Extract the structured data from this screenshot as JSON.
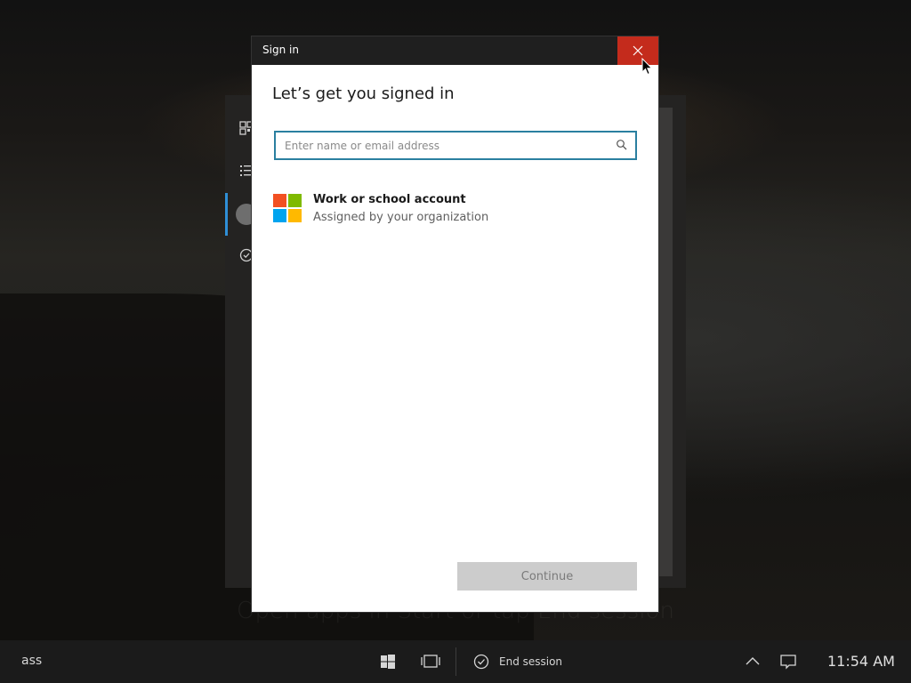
{
  "dialog": {
    "title": "Sign in",
    "heading": "Let’s get you signed in",
    "search": {
      "placeholder": "Enter name or email address",
      "value": ""
    },
    "account_option": {
      "title": "Work or school account",
      "subtitle": "Assigned by your organization"
    },
    "continue_label": "Continue"
  },
  "background": {
    "hint": "Open apps in Start or tap End session"
  },
  "taskbar": {
    "left_text": "ass",
    "end_session_label": "End session",
    "time": "11:54 AM"
  },
  "colors": {
    "accent": "#2f8fd6",
    "close_red": "#c42b1c",
    "search_border": "#2a7fa0",
    "ms_red": "#f25022",
    "ms_green": "#7fba00",
    "ms_blue": "#00a4ef",
    "ms_yellow": "#ffb900"
  },
  "icons": [
    "close-icon",
    "search-icon",
    "microsoft-logo-icon",
    "windows-start-icon",
    "task-view-icon",
    "checkmark-circle-icon",
    "chevron-up-icon",
    "notification-icon",
    "apps-grid-icon",
    "list-icon",
    "user-avatar-icon"
  ]
}
